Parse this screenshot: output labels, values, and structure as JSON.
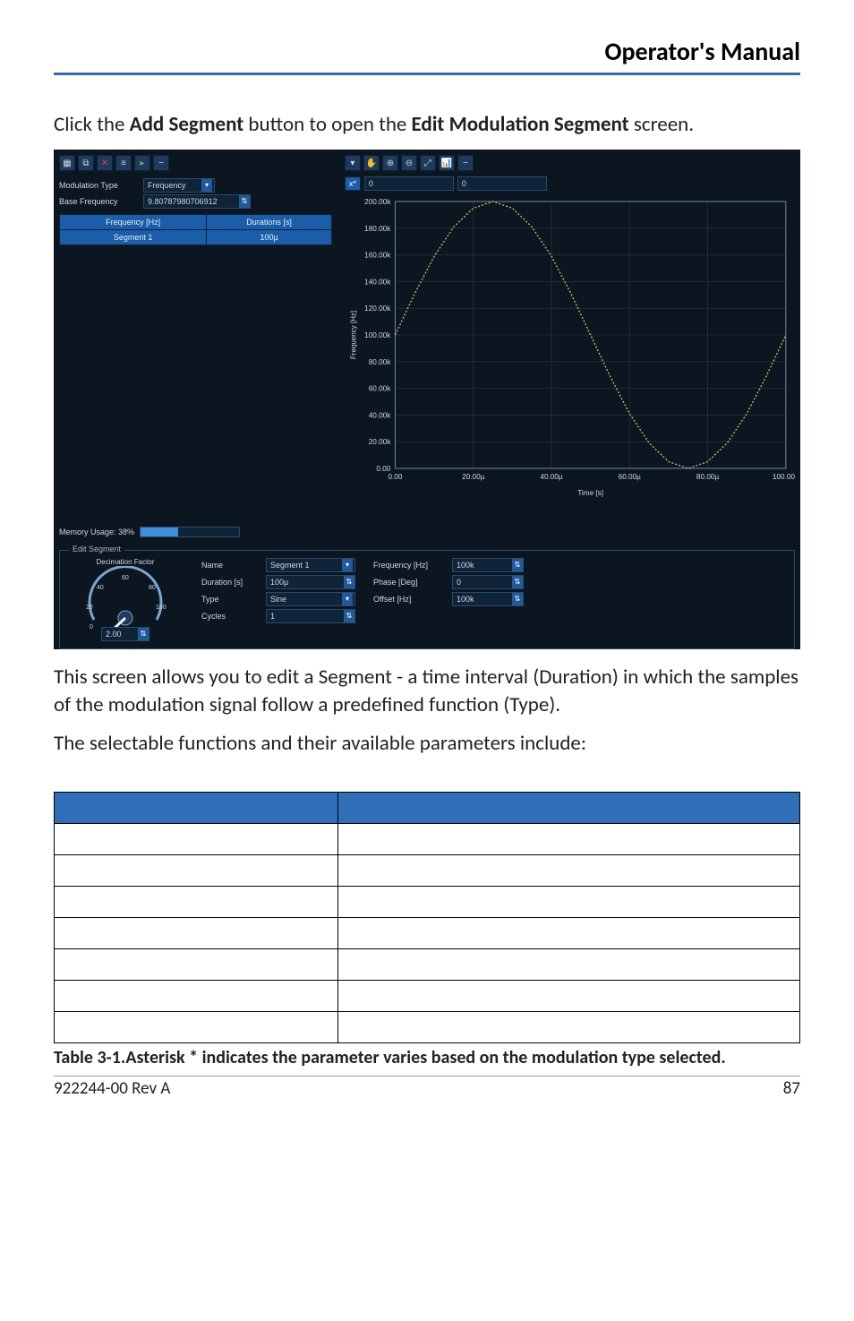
{
  "header": {
    "title": "Operator's Manual"
  },
  "intro": {
    "pre": "Click the ",
    "b1": "Add Segment",
    "mid": " button to open the ",
    "b2": "Edit Modulation Segment",
    "post": " screen."
  },
  "screenshot": {
    "left": {
      "toolbar": [
        "new",
        "copy",
        "delete",
        "settings",
        "add",
        "minus"
      ],
      "mod_type_label": "Modulation Type",
      "mod_type_value": "Frequency",
      "base_freq_label": "Base Frequency",
      "base_freq_value": "9.80787980706912",
      "table": {
        "h1": "Frequency [Hz]",
        "h2": "Durations [s]",
        "r1c1": "Segment 1",
        "r1c2": "100µ"
      },
      "mem_label": "Memory Usage: 38%",
      "mem_pct": 38
    },
    "right": {
      "toolbar": [
        "pointer",
        "hand",
        "zoom-in",
        "zoom-out",
        "zoom-fit",
        "chart",
        "minus"
      ],
      "coord_x_label": "x*",
      "coord_x_val": "0",
      "coord_y_val": "0",
      "xlabel": "Time [s]",
      "ylabel": "Frequency [Hz]"
    },
    "edit_segment": {
      "title": "Edit Segment",
      "gauge_title": "Decimation Factor",
      "gauge_ticks": [
        "0",
        "20",
        "40",
        "60",
        "80",
        "100"
      ],
      "gauge_value": "2.00",
      "col1": {
        "name_l": "Name",
        "name_v": "Segment 1",
        "dur_l": "Duration [s]",
        "dur_v": "100µ",
        "type_l": "Type",
        "type_v": "Sine",
        "cyc_l": "Cycles",
        "cyc_v": "1"
      },
      "col2": {
        "freq_l": "Frequency [Hz]",
        "freq_v": "100k",
        "phase_l": "Phase [Deg]",
        "phase_v": "0",
        "off_l": "Offset [Hz]",
        "off_v": "100k"
      }
    }
  },
  "chart_data": {
    "type": "line",
    "title": "",
    "xlabel": "Time [s]",
    "ylabel": "Frequency [Hz]",
    "xlim": [
      0,
      100
    ],
    "ylim": [
      0,
      200
    ],
    "x_tick_labels": [
      "0.00",
      "20.00µ",
      "40.00µ",
      "60.00µ",
      "80.00µ",
      "100.00µ"
    ],
    "y_tick_labels": [
      "0.00",
      "20.00k",
      "40.00k",
      "60.00k",
      "80.00k",
      "100.00k",
      "120.00k",
      "140.00k",
      "160.00k",
      "180.00k",
      "200.00k"
    ],
    "series": [
      {
        "name": "Frequency",
        "x": [
          0,
          5,
          10,
          15,
          20,
          25,
          30,
          35,
          40,
          45,
          50,
          55,
          60,
          65,
          70,
          75,
          80,
          85,
          90,
          95,
          100
        ],
        "values": [
          100,
          131,
          159,
          181,
          195,
          200,
          195,
          181,
          159,
          131,
          100,
          69,
          41,
          19,
          5,
          0,
          5,
          19,
          41,
          69,
          100
        ]
      }
    ]
  },
  "after_screenshot": "This screen allows you to edit a Segment - a time interval (Duration) in which the samples of the modulation signal follow a predefined function (Type).",
  "selectable_line": "The selectable functions and their available parameters include:",
  "fn_table": {
    "headers": [
      "",
      ""
    ],
    "rows": [
      [
        "",
        ""
      ],
      [
        "",
        ""
      ],
      [
        "",
        ""
      ],
      [
        "",
        ""
      ],
      [
        "",
        ""
      ],
      [
        "",
        ""
      ],
      [
        "",
        ""
      ]
    ]
  },
  "caption": "Table 3-1.Asterisk * indicates the parameter varies based on the modulation type selected.",
  "footer": {
    "left": "922244-00 Rev A",
    "right": "87"
  }
}
